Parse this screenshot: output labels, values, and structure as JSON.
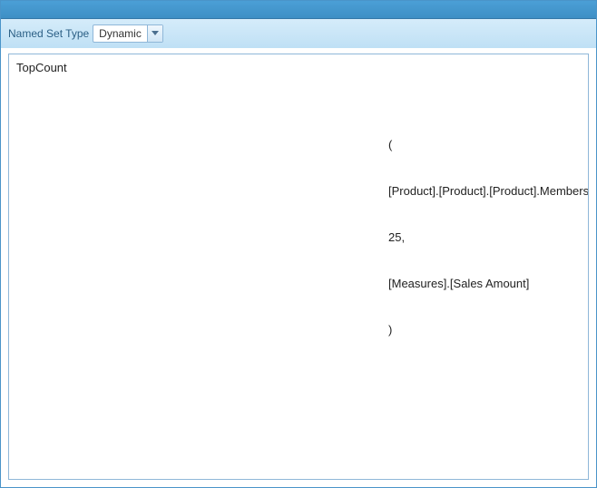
{
  "toolbar": {
    "label": "Named Set Type",
    "combo_value": "Dynamic"
  },
  "editor": {
    "left_text": "TopCount",
    "right_lines": [
      "(",
      "[Product].[Product].[Product].Members,",
      "25,",
      "[Measures].[Sales Amount]",
      ")"
    ]
  }
}
